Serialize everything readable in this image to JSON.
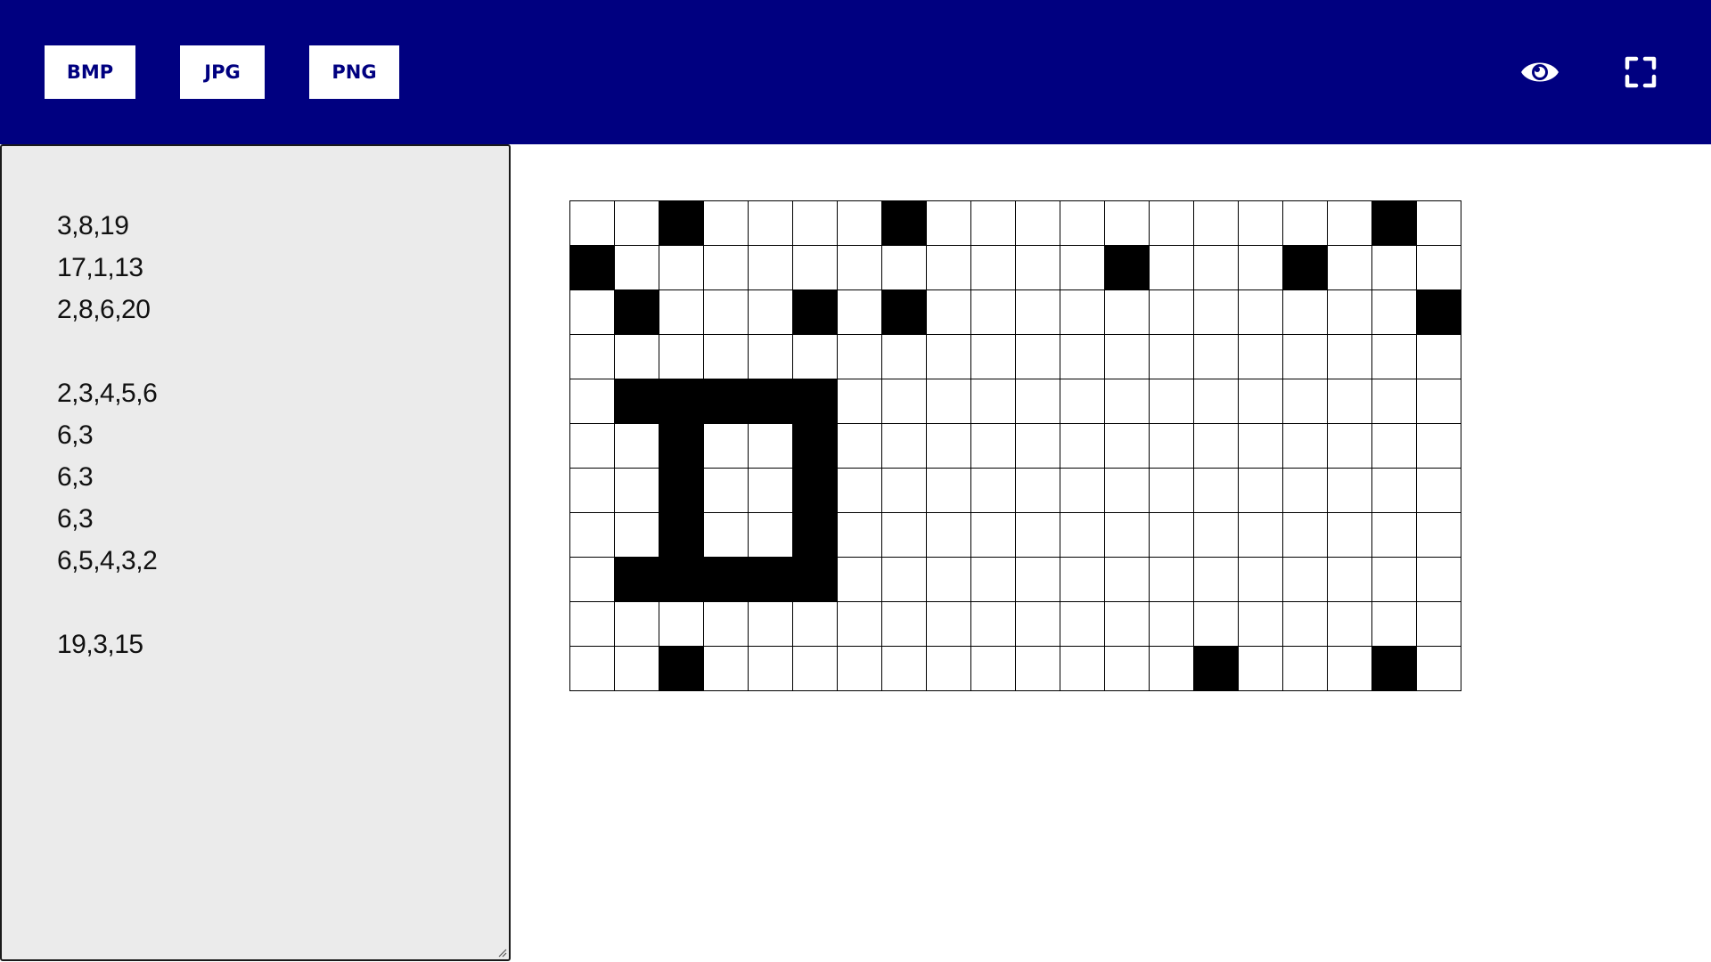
{
  "toolbar": {
    "buttons": [
      {
        "label": "BMP"
      },
      {
        "label": "JPG"
      },
      {
        "label": "PNG"
      }
    ],
    "icons": [
      "eye-icon",
      "fullscreen-icon"
    ],
    "accent_color": "#000080"
  },
  "editor": {
    "lines": [
      "3,8,19",
      "17,1,13",
      "2,8,6,20",
      "",
      "2,3,4,5,6",
      "6,3",
      "6,3",
      "6,3",
      "6,5,4,3,2",
      "",
      "19,3,15"
    ],
    "background": "#ebebeb"
  },
  "grid": {
    "columns": 20,
    "rows": 11,
    "filled": [
      [
        3,
        8,
        19
      ],
      [
        1,
        13,
        17
      ],
      [
        2,
        6,
        8,
        20
      ],
      [],
      [
        2,
        3,
        4,
        5,
        6
      ],
      [
        3,
        6
      ],
      [
        3,
        6
      ],
      [
        3,
        6
      ],
      [
        2,
        3,
        4,
        5,
        6
      ],
      [],
      [
        3,
        15,
        19
      ]
    ],
    "on_color": "#000000",
    "off_color": "#ffffff"
  }
}
